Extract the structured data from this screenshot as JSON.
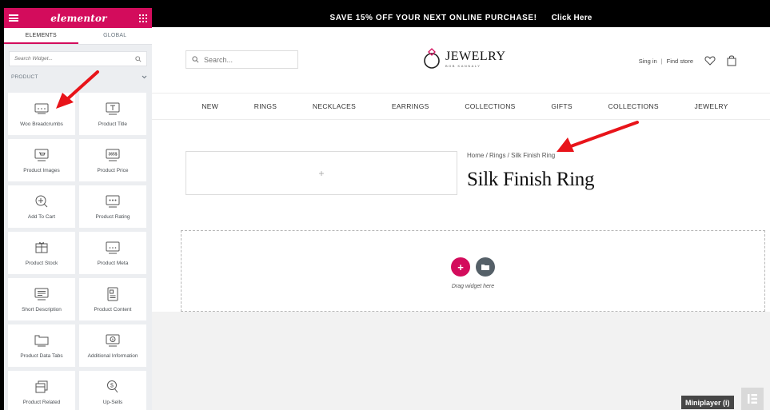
{
  "panel": {
    "logo": "elementor",
    "tabs": [
      {
        "label": "ELEMENTS",
        "active": true
      },
      {
        "label": "GLOBAL",
        "active": false
      }
    ],
    "search_placeholder": "Search Widget...",
    "category": "PRODUCT",
    "widgets": [
      {
        "label": "Woo Breadcrumbs",
        "icon": "breadcrumbs-icon"
      },
      {
        "label": "Product Title",
        "icon": "title-icon"
      },
      {
        "label": "Product Images",
        "icon": "images-icon"
      },
      {
        "label": "Product Price",
        "icon": "price-icon"
      },
      {
        "label": "Add To Cart",
        "icon": "add-to-cart-icon"
      },
      {
        "label": "Product Rating",
        "icon": "rating-icon"
      },
      {
        "label": "Product Stock",
        "icon": "stock-icon"
      },
      {
        "label": "Product Meta",
        "icon": "meta-icon"
      },
      {
        "label": "Short Description",
        "icon": "short-description-icon"
      },
      {
        "label": "Product Content",
        "icon": "content-icon"
      },
      {
        "label": "Product Data Tabs",
        "icon": "data-tabs-icon"
      },
      {
        "label": "Additional Information",
        "icon": "info-icon"
      },
      {
        "label": "Product Related",
        "icon": "related-icon"
      },
      {
        "label": "Up-Sells",
        "icon": "upsells-icon"
      }
    ],
    "price_glyph": "365$"
  },
  "promo": {
    "text": "SAVE 15% OFF YOUR NEXT ONLINE PURCHASE!",
    "cta": "Click Here"
  },
  "header": {
    "search_placeholder": "Search...",
    "brand_name": "JEWELRY",
    "brand_sub": "BOB KANNALY",
    "sign_in": "Sing in",
    "find_store": "Find store"
  },
  "nav": [
    "NEW",
    "RINGS",
    "NECKLACES",
    "EARRINGS",
    "COLLECTIONS",
    "GIFTS",
    "COLLECTIONS",
    "JEWELRY"
  ],
  "product": {
    "breadcrumb": "Home / Rings / Silk Finish Ring",
    "title": "Silk Finish Ring",
    "image_placeholder": "+"
  },
  "dropzone": {
    "add_symbol": "+",
    "hint": "Drag widget here"
  },
  "overlay": {
    "miniplayer": "Miniplayer (i)"
  },
  "colors": {
    "accent": "#d30c5c",
    "arrow": "#e8141a",
    "folder_button": "#556068"
  }
}
